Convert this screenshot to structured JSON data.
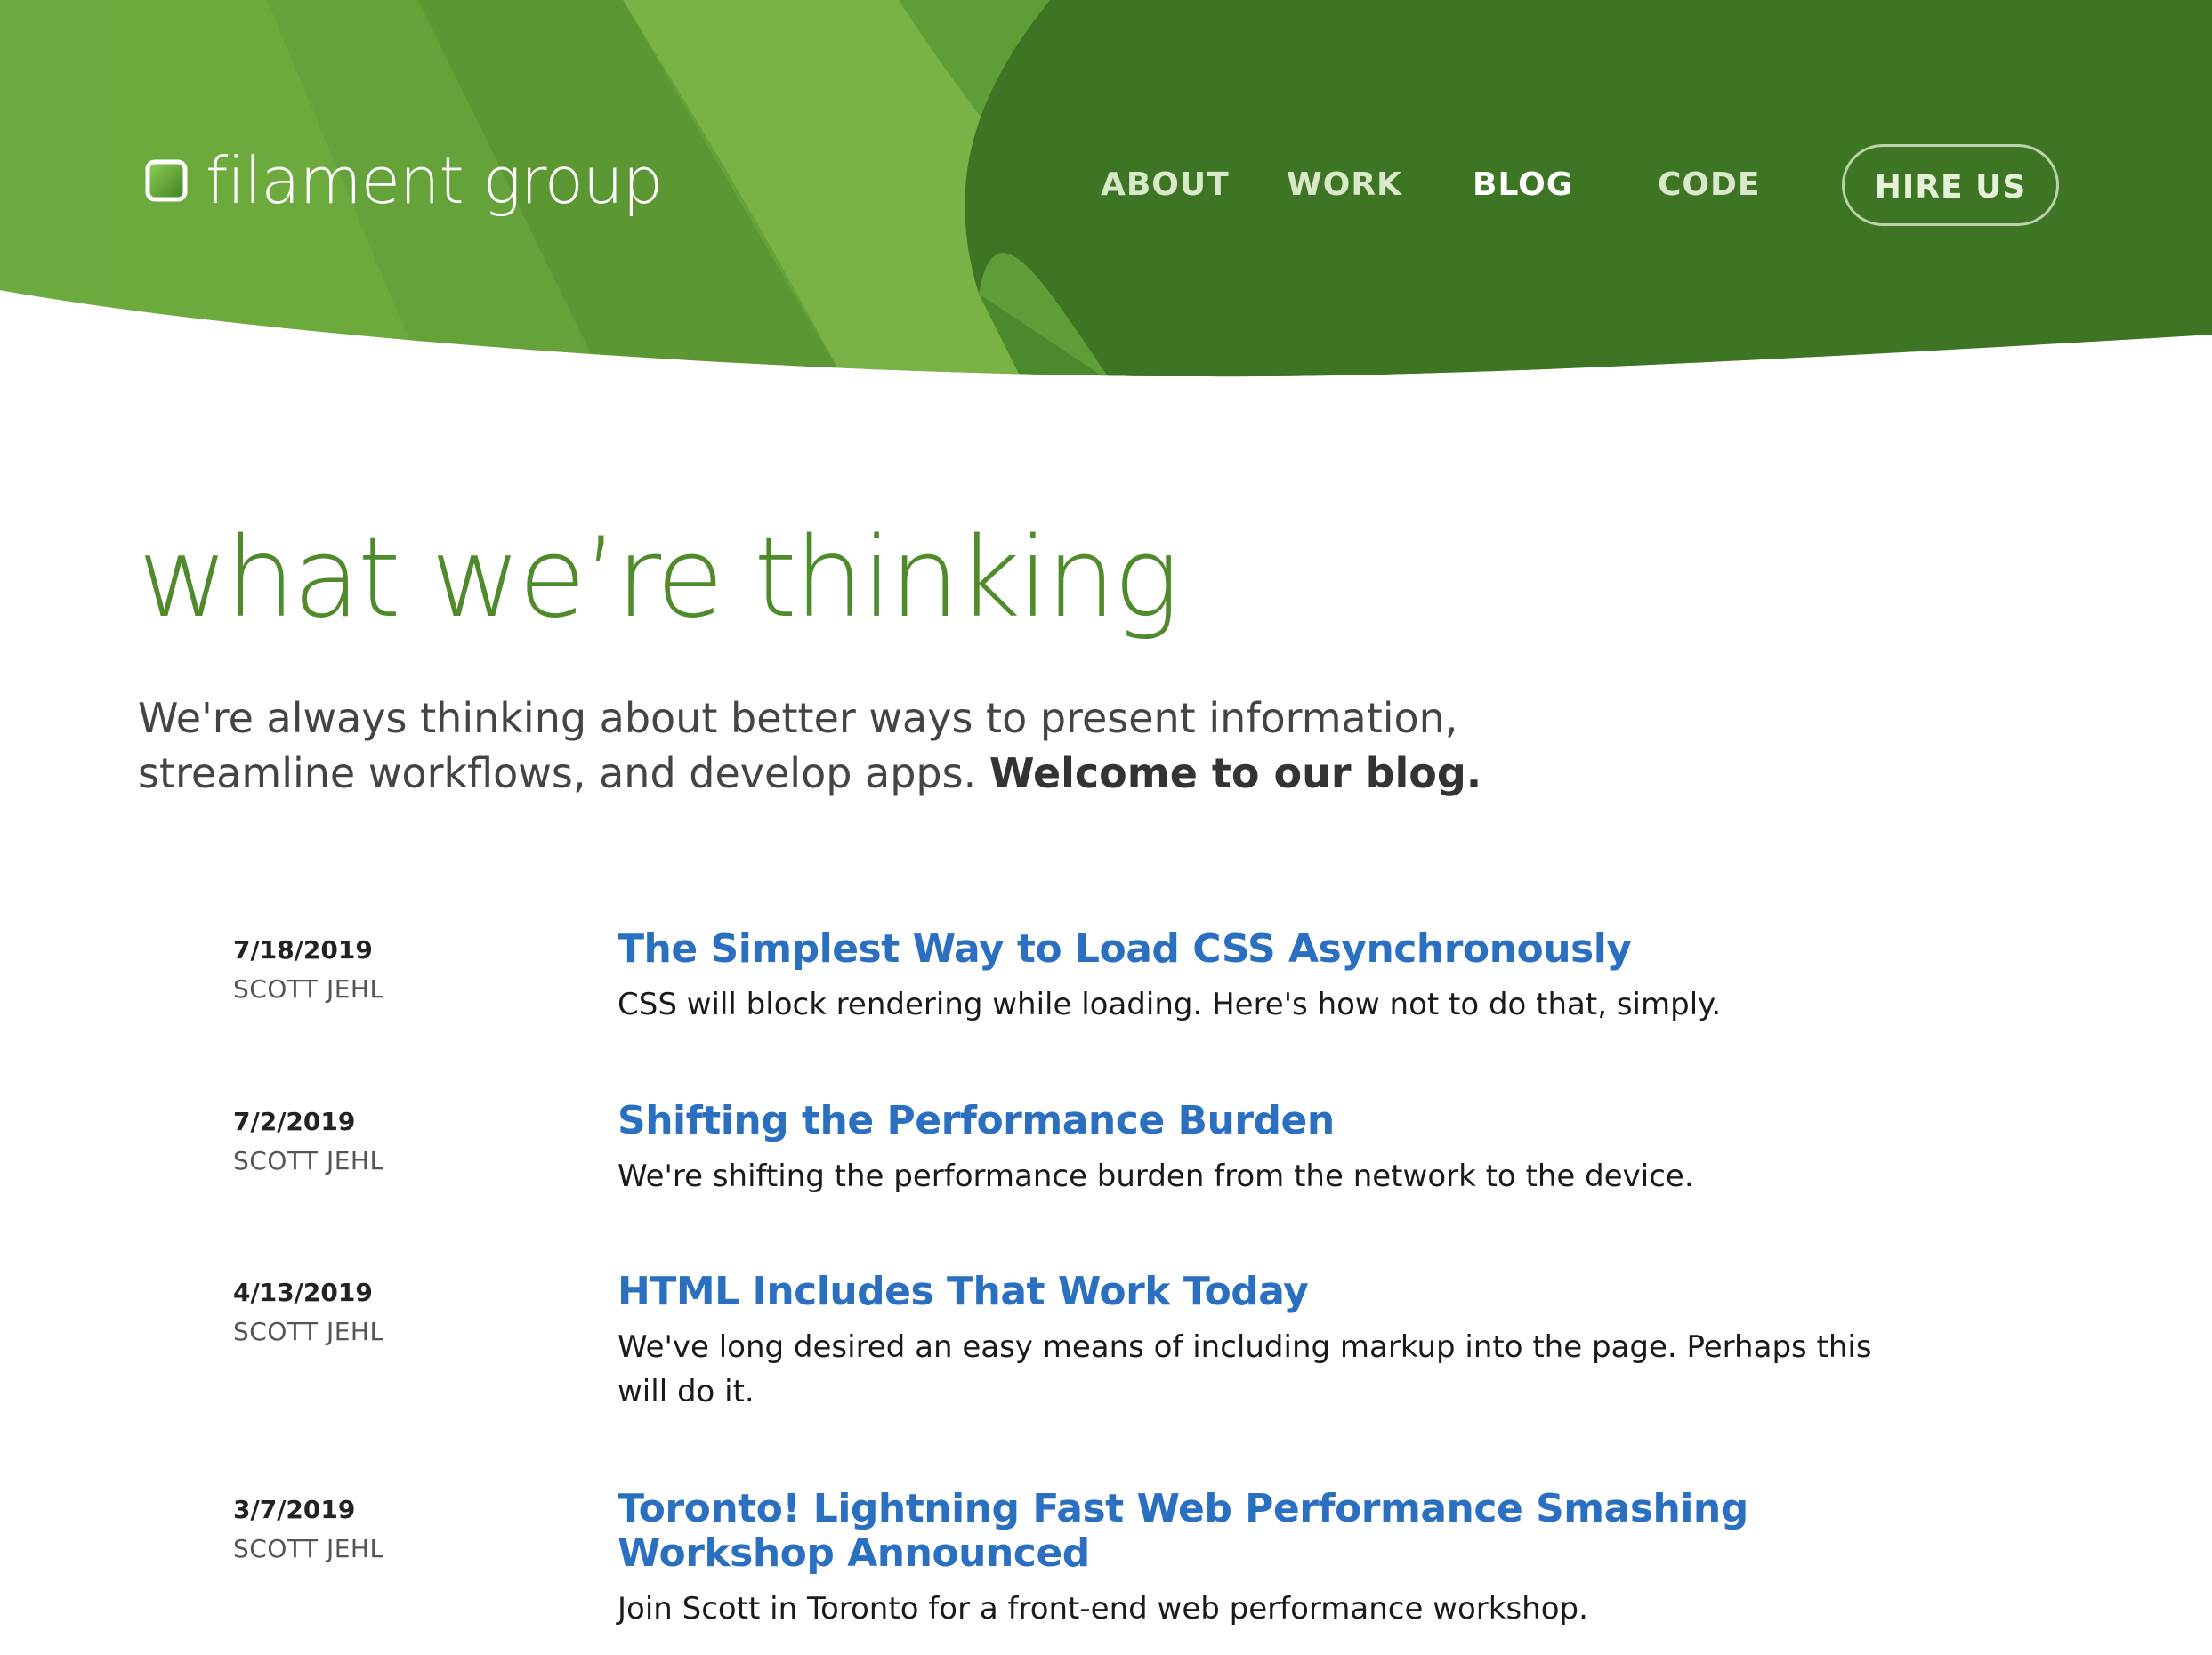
{
  "brand": {
    "name": "filament group",
    "colors": {
      "header_green": "#3d7524",
      "header_light_green": "#6ba63d",
      "title_green": "#4f8a2b",
      "link_blue": "#2a6fc0"
    }
  },
  "nav": {
    "items": [
      {
        "label": "ABOUT",
        "active": false
      },
      {
        "label": "WORK",
        "active": false
      },
      {
        "label": "BLOG",
        "active": true
      },
      {
        "label": "CODE",
        "active": false
      }
    ],
    "cta_label": "HIRE US"
  },
  "page": {
    "title": "what we’re thinking",
    "intro_text": "We're always thinking about better ways to present information, streamline workflows, and develop apps.",
    "intro_bold": "Welcome to our blog."
  },
  "posts": [
    {
      "date": "7/18/2019",
      "author": "SCOTT JEHL",
      "title": "The Simplest Way to Load CSS Asynchronously",
      "excerpt": "CSS will block rendering while loading. Here's how not to do that, simply."
    },
    {
      "date": "7/2/2019",
      "author": "SCOTT JEHL",
      "title": "Shifting the Performance Burden",
      "excerpt": "We're shifting the performance burden from the network to the device."
    },
    {
      "date": "4/13/2019",
      "author": "SCOTT JEHL",
      "title": "HTML Includes That Work Today",
      "excerpt": "We've long desired an easy means of including markup into the page. Perhaps this will do it."
    },
    {
      "date": "3/7/2019",
      "author": "SCOTT JEHL",
      "title": "Toronto! Lightning Fast Web Performance Smashing Workshop Announced",
      "excerpt": "Join Scott in Toronto for a front-end web performance workshop."
    }
  ]
}
